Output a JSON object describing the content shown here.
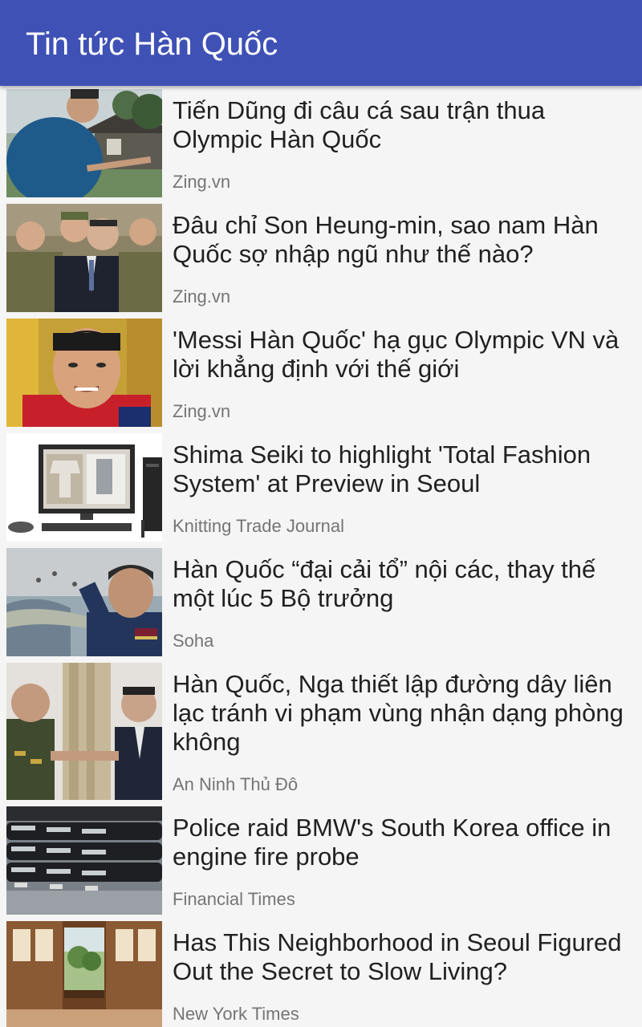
{
  "app": {
    "title": "Tin tức Hàn Quốc",
    "accent_color": "#3f51b5"
  },
  "articles": [
    {
      "title": "Tiến Dũng đi câu cá sau trận thua Olympic Hàn Quốc",
      "source": "Zing.vn",
      "thumbnail": "goalkeeper-outdoors-photo"
    },
    {
      "title": "Đâu chỉ Son Heung-min, sao nam Hàn Quốc sợ nhập ngũ như thế nào?",
      "source": "Zing.vn",
      "thumbnail": "soldiers-group-photo"
    },
    {
      "title": "'Messi Hàn Quốc' hạ gục Olympic VN và lời khẳng định với thế giới",
      "source": "Zing.vn",
      "thumbnail": "footballer-portrait-photo"
    },
    {
      "title": "Shima Seiki to highlight 'Total Fashion System' at Preview in Seoul",
      "source": "Knitting Trade Journal",
      "thumbnail": "computer-workstation-photo"
    },
    {
      "title": "Hàn Quốc “đại cải tổ” nội các, thay thế một lúc 5 Bộ trưởng",
      "source": "Soha",
      "thumbnail": "saluting-officer-photo"
    },
    {
      "title": "Hàn Quốc, Nga thiết lập đường dây liên lạc tránh vi phạm vùng nhận dạng phòng không",
      "source": "An Ninh Thủ Đô",
      "thumbnail": "officials-handshake-photo"
    },
    {
      "title": "Police raid BMW's South Korea office in engine fire probe",
      "source": "Financial Times",
      "thumbnail": "parked-cars-photo"
    },
    {
      "title": "Has This Neighborhood in Seoul Figured Out the Secret to Slow Living?",
      "source": "New York Times",
      "thumbnail": "hanok-window-photo"
    }
  ]
}
